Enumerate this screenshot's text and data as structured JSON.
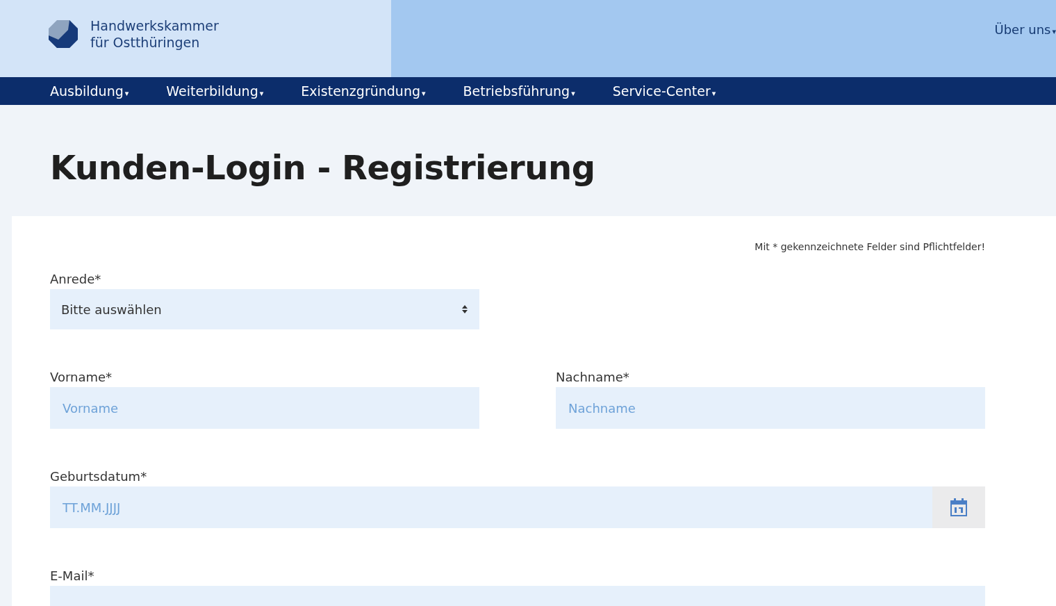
{
  "header": {
    "logo_line_1": "Handwerkskammer",
    "logo_line_2": "für Ostthüringen",
    "top_link": {
      "label": "Über uns",
      "caret": "▾"
    }
  },
  "nav": [
    {
      "label": "Ausbildung",
      "caret": "▾"
    },
    {
      "label": "Weiterbildung",
      "caret": "▾"
    },
    {
      "label": "Existenzgründung",
      "caret": "▾"
    },
    {
      "label": "Betriebsführung",
      "caret": "▾"
    },
    {
      "label": "Service-Center",
      "caret": "▾"
    }
  ],
  "page_title": "Kunden-Login - Registrierung",
  "form": {
    "required_note": "Mit * gekennzeichnete Felder sind Pflichtfelder!",
    "rows": [
      [
        {
          "kind": "select",
          "label": "Anrede*",
          "value": "Bitte auswählen"
        }
      ],
      [
        {
          "kind": "text",
          "label": "Vorname*",
          "placeholder": "Vorname"
        },
        {
          "kind": "text",
          "label": "Nachname*",
          "placeholder": "Nachname"
        }
      ],
      [
        {
          "kind": "date",
          "label": "Geburtsdatum*",
          "placeholder": "TT.MM.JJJJ"
        }
      ],
      [
        {
          "kind": "text",
          "label": "E-Mail*"
        }
      ]
    ]
  }
}
